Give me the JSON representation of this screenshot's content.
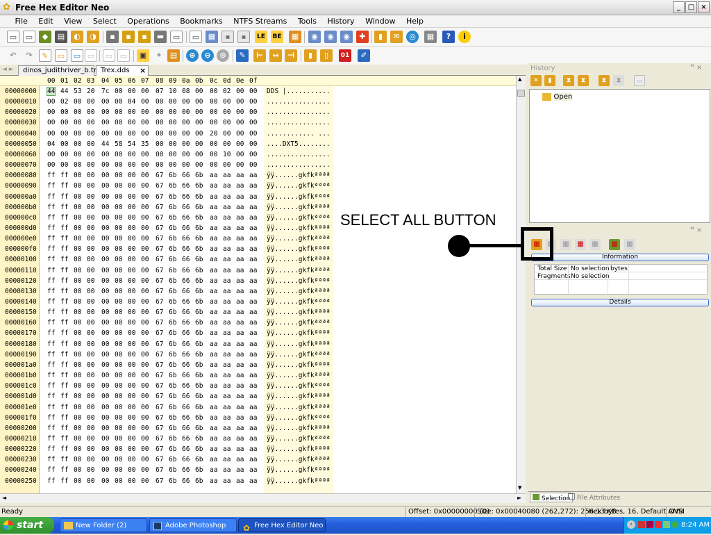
{
  "window": {
    "title": "Free Hex Editor Neo",
    "controls": [
      "_",
      "□",
      "×"
    ]
  },
  "menu": [
    "File",
    "Edit",
    "View",
    "Select",
    "Operations",
    "Bookmarks",
    "NTFS Streams",
    "Tools",
    "History",
    "Window",
    "Help"
  ],
  "tabs": [
    {
      "label": "dinos_judithriver_b.tml"
    },
    {
      "label": "Trex.dds"
    }
  ],
  "tab_close": "×",
  "tab_nav": "◄ ►",
  "hex_header": {
    "columns": [
      "00",
      "01",
      "02",
      "03",
      "04",
      "05",
      "06",
      "07",
      "08",
      "09",
      "0a",
      "0b",
      "0c",
      "0d",
      "0e",
      "0f"
    ]
  },
  "rows": [
    {
      "offset": "00000000",
      "bytes": [
        "44",
        "44",
        "53",
        "20",
        "7c",
        "00",
        "00",
        "00",
        "07",
        "10",
        "08",
        "00",
        "00",
        "02",
        "00",
        "00"
      ],
      "ascii": "DDS |..........."
    },
    {
      "offset": "00000010",
      "bytes": [
        "00",
        "02",
        "00",
        "00",
        "00",
        "00",
        "04",
        "00",
        "00",
        "00",
        "00",
        "00",
        "00",
        "00",
        "00",
        "00"
      ],
      "ascii": "................"
    },
    {
      "offset": "00000020",
      "bytes": [
        "00",
        "00",
        "00",
        "00",
        "00",
        "00",
        "00",
        "00",
        "00",
        "00",
        "00",
        "00",
        "00",
        "00",
        "00",
        "00"
      ],
      "ascii": "................"
    },
    {
      "offset": "00000030",
      "bytes": [
        "00",
        "00",
        "00",
        "00",
        "00",
        "00",
        "00",
        "00",
        "00",
        "00",
        "00",
        "00",
        "00",
        "00",
        "00",
        "00"
      ],
      "ascii": "................"
    },
    {
      "offset": "00000040",
      "bytes": [
        "00",
        "00",
        "00",
        "00",
        "00",
        "00",
        "00",
        "00",
        "00",
        "00",
        "00",
        "00",
        "20",
        "00",
        "00",
        "00"
      ],
      "ascii": "............ ..."
    },
    {
      "offset": "00000050",
      "bytes": [
        "04",
        "00",
        "00",
        "00",
        "44",
        "58",
        "54",
        "35",
        "00",
        "00",
        "00",
        "00",
        "00",
        "00",
        "00",
        "00"
      ],
      "ascii": "....DXT5........"
    },
    {
      "offset": "00000060",
      "bytes": [
        "00",
        "00",
        "00",
        "00",
        "00",
        "00",
        "00",
        "00",
        "00",
        "00",
        "00",
        "00",
        "00",
        "10",
        "00",
        "00"
      ],
      "ascii": "................"
    },
    {
      "offset": "00000070",
      "bytes": [
        "00",
        "00",
        "00",
        "00",
        "00",
        "00",
        "00",
        "00",
        "00",
        "00",
        "00",
        "00",
        "00",
        "00",
        "00",
        "00"
      ],
      "ascii": "................"
    },
    {
      "offset": "00000080",
      "bytes": [
        "ff",
        "ff",
        "00",
        "00",
        "00",
        "00",
        "00",
        "00",
        "67",
        "6b",
        "66",
        "6b",
        "aa",
        "aa",
        "aa",
        "aa"
      ],
      "ascii": "ÿÿ......gkfkªªªª"
    },
    {
      "offset": "00000090",
      "bytes": [
        "ff",
        "ff",
        "00",
        "00",
        "00",
        "00",
        "00",
        "00",
        "67",
        "6b",
        "66",
        "6b",
        "aa",
        "aa",
        "aa",
        "aa"
      ],
      "ascii": "ÿÿ......gkfkªªªª"
    },
    {
      "offset": "000000a0",
      "bytes": [
        "ff",
        "ff",
        "00",
        "00",
        "00",
        "00",
        "00",
        "00",
        "67",
        "6b",
        "66",
        "6b",
        "aa",
        "aa",
        "aa",
        "aa"
      ],
      "ascii": "ÿÿ......gkfkªªªª"
    },
    {
      "offset": "000000b0",
      "bytes": [
        "ff",
        "ff",
        "00",
        "00",
        "00",
        "00",
        "00",
        "00",
        "67",
        "6b",
        "66",
        "6b",
        "aa",
        "aa",
        "aa",
        "aa"
      ],
      "ascii": "ÿÿ......gkfkªªªª"
    },
    {
      "offset": "000000c0",
      "bytes": [
        "ff",
        "ff",
        "00",
        "00",
        "00",
        "00",
        "00",
        "00",
        "67",
        "6b",
        "66",
        "6b",
        "aa",
        "aa",
        "aa",
        "aa"
      ],
      "ascii": "ÿÿ......gkfkªªªª"
    },
    {
      "offset": "000000d0",
      "bytes": [
        "ff",
        "ff",
        "00",
        "00",
        "00",
        "00",
        "00",
        "00",
        "67",
        "6b",
        "66",
        "6b",
        "aa",
        "aa",
        "aa",
        "aa"
      ],
      "ascii": "ÿÿ......gkfkªªªª"
    },
    {
      "offset": "000000e0",
      "bytes": [
        "ff",
        "ff",
        "00",
        "00",
        "00",
        "00",
        "00",
        "00",
        "67",
        "6b",
        "66",
        "6b",
        "aa",
        "aa",
        "aa",
        "aa"
      ],
      "ascii": "ÿÿ......gkfkªªªª"
    },
    {
      "offset": "000000f0",
      "bytes": [
        "ff",
        "ff",
        "00",
        "00",
        "00",
        "00",
        "00",
        "00",
        "67",
        "6b",
        "66",
        "6b",
        "aa",
        "aa",
        "aa",
        "aa"
      ],
      "ascii": "ÿÿ......gkfkªªªª"
    },
    {
      "offset": "00000100",
      "bytes": [
        "ff",
        "ff",
        "00",
        "00",
        "00",
        "00",
        "00",
        "00",
        "67",
        "6b",
        "66",
        "6b",
        "aa",
        "aa",
        "aa",
        "aa"
      ],
      "ascii": "ÿÿ......gkfkªªªª"
    },
    {
      "offset": "00000110",
      "bytes": [
        "ff",
        "ff",
        "00",
        "00",
        "00",
        "00",
        "00",
        "00",
        "67",
        "6b",
        "66",
        "6b",
        "aa",
        "aa",
        "aa",
        "aa"
      ],
      "ascii": "ÿÿ......gkfkªªªª"
    },
    {
      "offset": "00000120",
      "bytes": [
        "ff",
        "ff",
        "00",
        "00",
        "00",
        "00",
        "00",
        "00",
        "67",
        "6b",
        "66",
        "6b",
        "aa",
        "aa",
        "aa",
        "aa"
      ],
      "ascii": "ÿÿ......gkfkªªªª"
    },
    {
      "offset": "00000130",
      "bytes": [
        "ff",
        "ff",
        "00",
        "00",
        "00",
        "00",
        "00",
        "00",
        "67",
        "6b",
        "66",
        "6b",
        "aa",
        "aa",
        "aa",
        "aa"
      ],
      "ascii": "ÿÿ......gkfkªªªª"
    },
    {
      "offset": "00000140",
      "bytes": [
        "ff",
        "ff",
        "00",
        "00",
        "00",
        "00",
        "00",
        "00",
        "67",
        "6b",
        "66",
        "6b",
        "aa",
        "aa",
        "aa",
        "aa"
      ],
      "ascii": "ÿÿ......gkfkªªªª"
    },
    {
      "offset": "00000150",
      "bytes": [
        "ff",
        "ff",
        "00",
        "00",
        "00",
        "00",
        "00",
        "00",
        "67",
        "6b",
        "66",
        "6b",
        "aa",
        "aa",
        "aa",
        "aa"
      ],
      "ascii": "ÿÿ......gkfkªªªª"
    },
    {
      "offset": "00000160",
      "bytes": [
        "ff",
        "ff",
        "00",
        "00",
        "00",
        "00",
        "00",
        "00",
        "67",
        "6b",
        "66",
        "6b",
        "aa",
        "aa",
        "aa",
        "aa"
      ],
      "ascii": "ÿÿ......gkfkªªªª"
    },
    {
      "offset": "00000170",
      "bytes": [
        "ff",
        "ff",
        "00",
        "00",
        "00",
        "00",
        "00",
        "00",
        "67",
        "6b",
        "66",
        "6b",
        "aa",
        "aa",
        "aa",
        "aa"
      ],
      "ascii": "ÿÿ......gkfkªªªª"
    },
    {
      "offset": "00000180",
      "bytes": [
        "ff",
        "ff",
        "00",
        "00",
        "00",
        "00",
        "00",
        "00",
        "67",
        "6b",
        "66",
        "6b",
        "aa",
        "aa",
        "aa",
        "aa"
      ],
      "ascii": "ÿÿ......gkfkªªªª"
    },
    {
      "offset": "00000190",
      "bytes": [
        "ff",
        "ff",
        "00",
        "00",
        "00",
        "00",
        "00",
        "00",
        "67",
        "6b",
        "66",
        "6b",
        "aa",
        "aa",
        "aa",
        "aa"
      ],
      "ascii": "ÿÿ......gkfkªªªª"
    },
    {
      "offset": "000001a0",
      "bytes": [
        "ff",
        "ff",
        "00",
        "00",
        "00",
        "00",
        "00",
        "00",
        "67",
        "6b",
        "66",
        "6b",
        "aa",
        "aa",
        "aa",
        "aa"
      ],
      "ascii": "ÿÿ......gkfkªªªª"
    },
    {
      "offset": "000001b0",
      "bytes": [
        "ff",
        "ff",
        "00",
        "00",
        "00",
        "00",
        "00",
        "00",
        "67",
        "6b",
        "66",
        "6b",
        "aa",
        "aa",
        "aa",
        "aa"
      ],
      "ascii": "ÿÿ......gkfkªªªª"
    },
    {
      "offset": "000001c0",
      "bytes": [
        "ff",
        "ff",
        "00",
        "00",
        "00",
        "00",
        "00",
        "00",
        "67",
        "6b",
        "66",
        "6b",
        "aa",
        "aa",
        "aa",
        "aa"
      ],
      "ascii": "ÿÿ......gkfkªªªª"
    },
    {
      "offset": "000001d0",
      "bytes": [
        "ff",
        "ff",
        "00",
        "00",
        "00",
        "00",
        "00",
        "00",
        "67",
        "6b",
        "66",
        "6b",
        "aa",
        "aa",
        "aa",
        "aa"
      ],
      "ascii": "ÿÿ......gkfkªªªª"
    },
    {
      "offset": "000001e0",
      "bytes": [
        "ff",
        "ff",
        "00",
        "00",
        "00",
        "00",
        "00",
        "00",
        "67",
        "6b",
        "66",
        "6b",
        "aa",
        "aa",
        "aa",
        "aa"
      ],
      "ascii": "ÿÿ......gkfkªªªª"
    },
    {
      "offset": "000001f0",
      "bytes": [
        "ff",
        "ff",
        "00",
        "00",
        "00",
        "00",
        "00",
        "00",
        "67",
        "6b",
        "66",
        "6b",
        "aa",
        "aa",
        "aa",
        "aa"
      ],
      "ascii": "ÿÿ......gkfkªªªª"
    },
    {
      "offset": "00000200",
      "bytes": [
        "ff",
        "ff",
        "00",
        "00",
        "00",
        "00",
        "00",
        "00",
        "67",
        "6b",
        "66",
        "6b",
        "aa",
        "aa",
        "aa",
        "aa"
      ],
      "ascii": "ÿÿ......gkfkªªªª"
    },
    {
      "offset": "00000210",
      "bytes": [
        "ff",
        "ff",
        "00",
        "00",
        "00",
        "00",
        "00",
        "00",
        "67",
        "6b",
        "66",
        "6b",
        "aa",
        "aa",
        "aa",
        "aa"
      ],
      "ascii": "ÿÿ......gkfkªªªª"
    },
    {
      "offset": "00000220",
      "bytes": [
        "ff",
        "ff",
        "00",
        "00",
        "00",
        "00",
        "00",
        "00",
        "67",
        "6b",
        "66",
        "6b",
        "aa",
        "aa",
        "aa",
        "aa"
      ],
      "ascii": "ÿÿ......gkfkªªªª"
    },
    {
      "offset": "00000230",
      "bytes": [
        "ff",
        "ff",
        "00",
        "00",
        "00",
        "00",
        "00",
        "00",
        "67",
        "6b",
        "66",
        "6b",
        "aa",
        "aa",
        "aa",
        "aa"
      ],
      "ascii": "ÿÿ......gkfkªªªª"
    },
    {
      "offset": "00000240",
      "bytes": [
        "ff",
        "ff",
        "00",
        "00",
        "00",
        "00",
        "00",
        "00",
        "67",
        "6b",
        "66",
        "6b",
        "aa",
        "aa",
        "aa",
        "aa"
      ],
      "ascii": "ÿÿ......gkfkªªªª"
    },
    {
      "offset": "00000250",
      "bytes": [
        "ff",
        "ff",
        "00",
        "00",
        "00",
        "00",
        "00",
        "00",
        "67",
        "6b",
        "66",
        "6b",
        "aa",
        "aa",
        "aa",
        "aa"
      ],
      "ascii": "ÿÿ......gkfkªªªª"
    }
  ],
  "history_panel": {
    "title": "History",
    "item": "Open",
    "pin": "ꟸ ×"
  },
  "selection_panel": {
    "pin": "ꟸ ×",
    "information_header": "Information",
    "details_header": "Details",
    "info_rows": [
      {
        "label": "Total Size",
        "value": "No selection",
        "unit": "bytes"
      },
      {
        "label": "Fragments",
        "value": "No selection",
        "unit": ""
      }
    ]
  },
  "bottom_tabs": {
    "selection": "Selection",
    "file_attributes": "File Attributes"
  },
  "status": {
    "ready": "Ready",
    "offset": "Offset: 0x00000000 (0)",
    "size": "Size: 0x00040080 (262,272): 256.13 KB",
    "mode": "Hex bytes, 16, Default ANSI",
    "ovr": "OVR"
  },
  "taskbar": {
    "start": "start",
    "tasks": [
      "New Folder (2)",
      "Adobe Photoshop",
      "Free Hex Editor Neo"
    ],
    "clock": "8:24 AM"
  },
  "annotation": {
    "text": "SELECT ALL BUTTON"
  },
  "colors": {
    "offset_bg": "#fff4c6",
    "header_bg": "#fffbd6",
    "accent": "#245edb",
    "selected_byte": "#cde8cd"
  }
}
